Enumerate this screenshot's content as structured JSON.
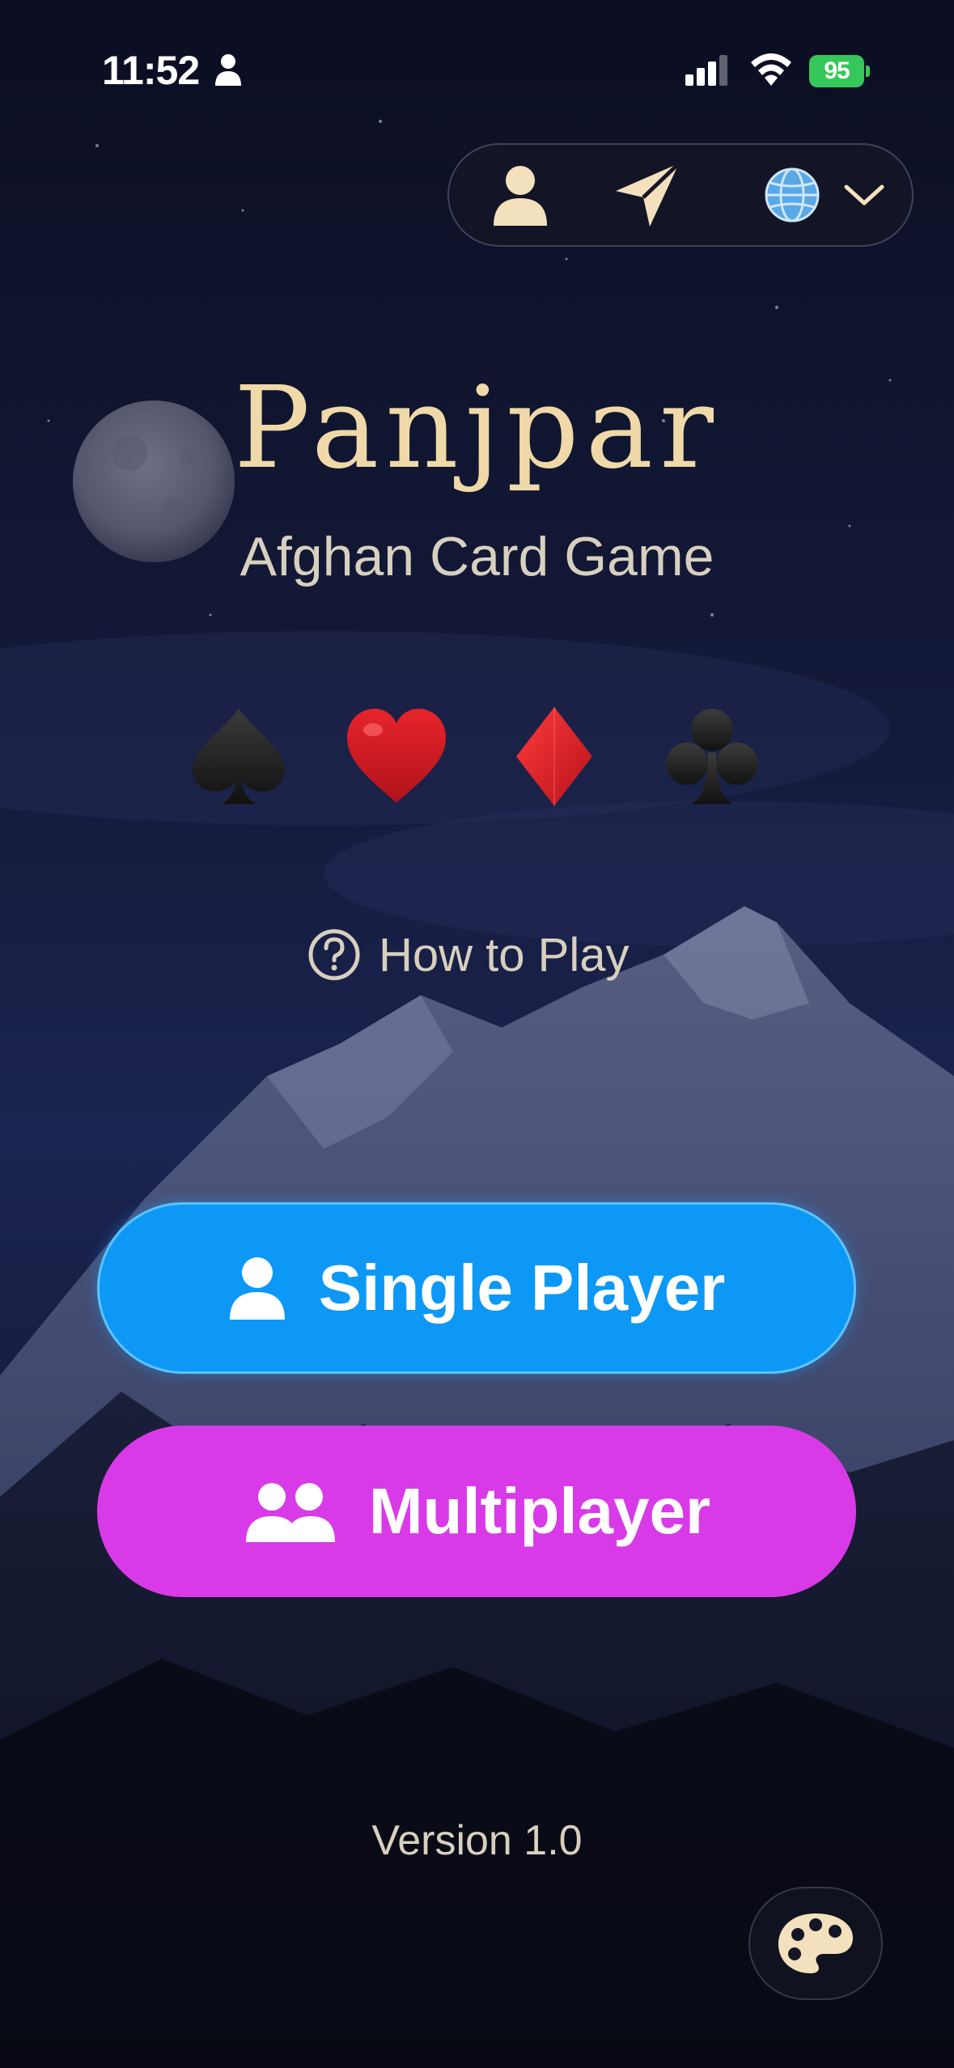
{
  "status_bar": {
    "time": "11:52",
    "battery_level": "95"
  },
  "toolbar": {
    "profile_icon": "person-icon",
    "send_icon": "paper-plane-icon",
    "language_icon": "globe-icon",
    "dropdown_icon": "chevron-down-icon"
  },
  "header": {
    "title": "Panjpar",
    "subtitle": "Afghan Card Game"
  },
  "suits": [
    "spade-icon",
    "heart-icon",
    "diamond-icon",
    "club-icon"
  ],
  "how_to_play": {
    "label": "How to Play",
    "icon": "question-circle-icon"
  },
  "buttons": {
    "single_player": {
      "label": "Single Player",
      "icon": "person-icon",
      "color": "#0d98f6"
    },
    "multiplayer": {
      "label": "Multiplayer",
      "icon": "two-people-icon",
      "color": "#d93ae8"
    }
  },
  "footer": {
    "version": "Version 1.0",
    "theme_icon": "palette-icon"
  },
  "colors": {
    "title": "#f0d9a8",
    "text": "#d8d0be",
    "background": "#0c0f22"
  }
}
